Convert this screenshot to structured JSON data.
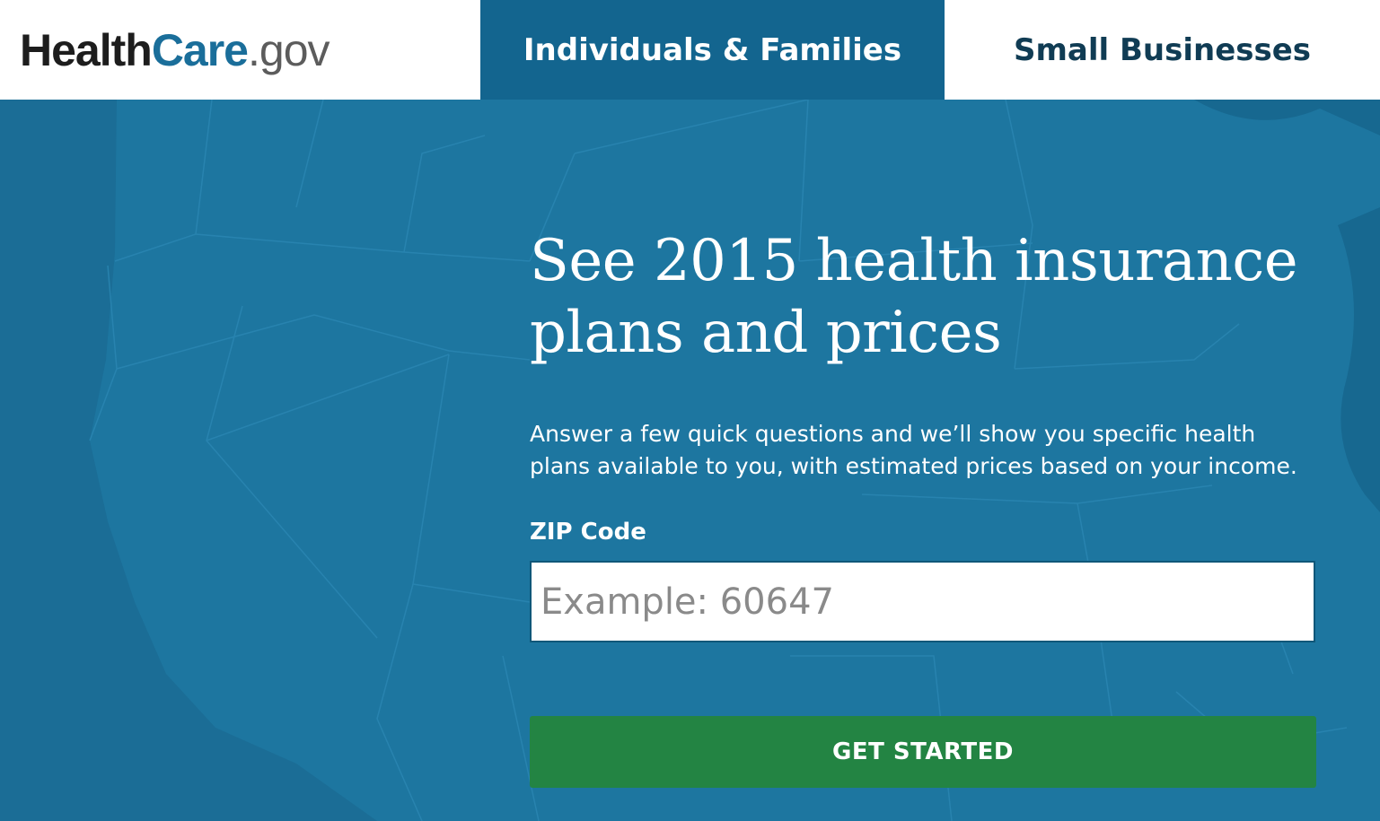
{
  "header": {
    "logo": {
      "part1": "Health",
      "part2": "Care",
      "part3": ".gov"
    },
    "tabs": [
      {
        "label": "Individuals & Families",
        "active": true
      },
      {
        "label": "Small Businesses",
        "active": false
      }
    ]
  },
  "hero": {
    "headline_line1": "See 2015 health insurance",
    "headline_line2": "plans and prices",
    "description": "Answer a few quick questions and we’ll show you specific health plans available to you, with estimated prices based on your income.",
    "zip_label": "ZIP Code",
    "zip_placeholder": "Example: 60647",
    "zip_value": "",
    "cta_label": "GET STARTED"
  },
  "colors": {
    "brand_blue": "#1b6d96",
    "active_tab": "#13658f",
    "tab_text_dark": "#103c54",
    "cta_green": "#238443",
    "map_land": "#1f7aa4"
  }
}
